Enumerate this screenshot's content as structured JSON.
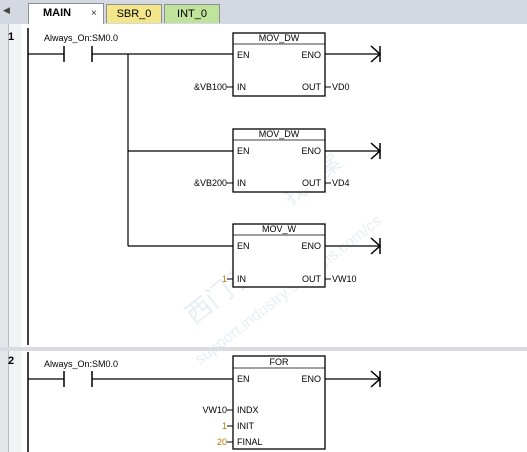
{
  "tabs": {
    "main": "MAIN",
    "close": "×",
    "sbr": "SBR_0",
    "int": "INT_0"
  },
  "networks": [
    {
      "number": "1",
      "contact_label": "Always_On:SM0.0",
      "boxes": [
        {
          "title": "MOV_DW",
          "en": "EN",
          "eno": "ENO",
          "in": "IN",
          "out": "OUT",
          "in_val": "&VB100",
          "out_val": "VD0"
        },
        {
          "title": "MOV_DW",
          "en": "EN",
          "eno": "ENO",
          "in": "IN",
          "out": "OUT",
          "in_val": "&VB200",
          "out_val": "VD4"
        },
        {
          "title": "MOV_W",
          "en": "EN",
          "eno": "ENO",
          "in": "IN",
          "out": "OUT",
          "in_val": "1",
          "out_val": "VW10"
        }
      ]
    },
    {
      "number": "2",
      "contact_label": "Always_On:SM0.0",
      "for_box": {
        "title": "FOR",
        "en": "EN",
        "eno": "ENO",
        "indx": "INDX",
        "init": "INIT",
        "final": "FINAL",
        "indx_val": "VW10",
        "init_val": "1",
        "final_val": "20"
      }
    }
  ],
  "watermark": {
    "line1": "西门子工业",
    "line2": "support.industry.siemens.com/cs",
    "line3": "找答案"
  },
  "colors": {
    "line": "#000000",
    "constant": "#b07800",
    "sbr_tab": "#f3e58a",
    "int_tab": "#bfe39b"
  }
}
